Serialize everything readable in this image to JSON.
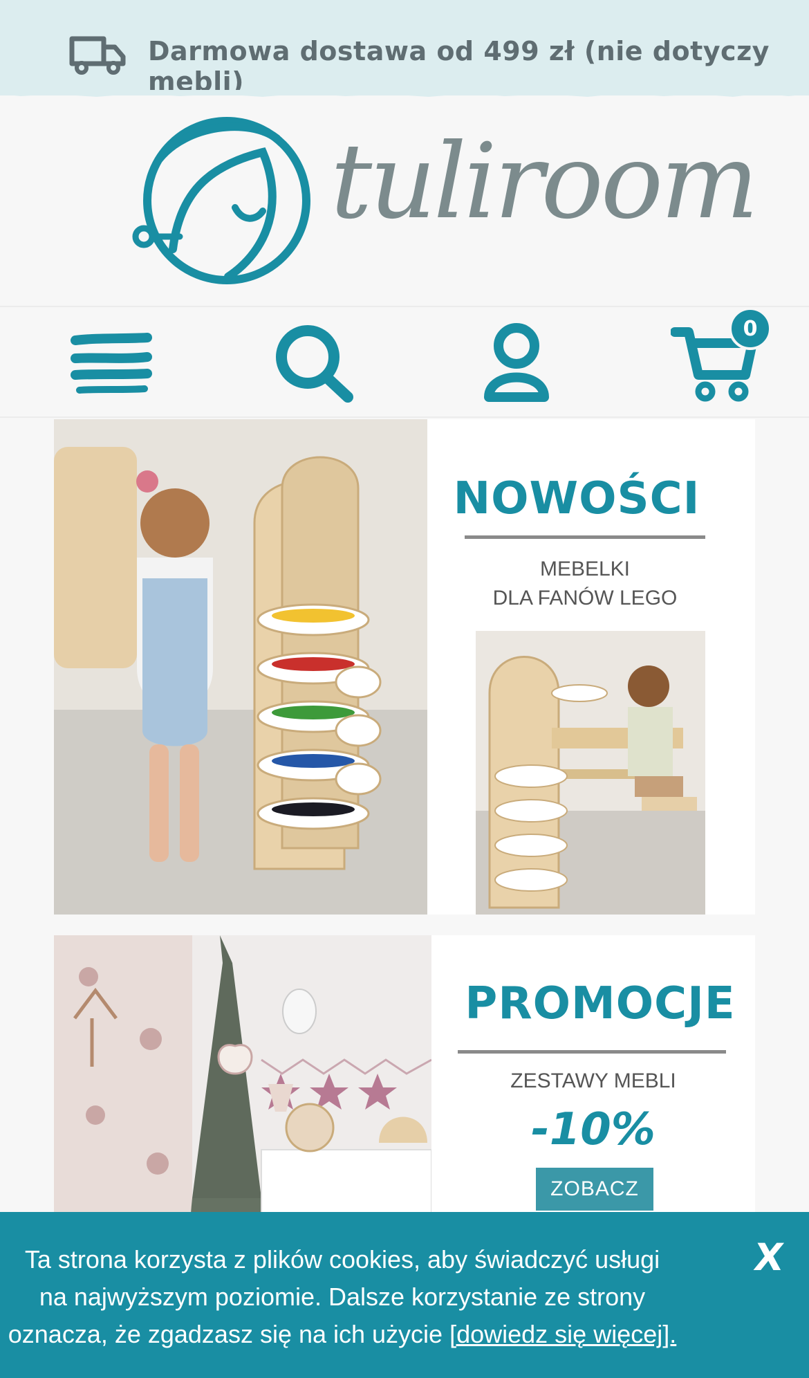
{
  "promo_bar": {
    "text": "Darmowa dostawa od 499 zł (nie dotyczy mebli)",
    "icon": "truck-icon"
  },
  "logo": {
    "wordmark": "tuliroom"
  },
  "nav": {
    "menu_icon": "hamburger-menu-icon",
    "search_icon": "search-icon",
    "account_icon": "user-icon",
    "cart_icon": "cart-icon",
    "cart_count": "0"
  },
  "banners": [
    {
      "title": "NOWOŚCI",
      "subtitle_line1": "MEBELKI",
      "subtitle_line2": "DLA FANÓW LEGO"
    },
    {
      "title": "PROMOCJE",
      "subtitle": "ZESTAWY MEBLI",
      "discount": "-10%",
      "button_label": "ZOBACZ"
    }
  ],
  "cookie_bar": {
    "text_line1": "Ta strona korzysta z plików cookies, aby świadczyć usługi",
    "text_line2": "na najwyższym poziomie. Dalsze korzystanie ze strony",
    "text_line3_prefix": "oznacza, że zgadzasz się na ich użycie ",
    "link_text": "[dowiedz się więcej].",
    "close_label": "X"
  },
  "colors": {
    "brand_teal": "#198ea3",
    "promo_bg": "#dcedef",
    "logo_grey": "#7c8b8d"
  }
}
